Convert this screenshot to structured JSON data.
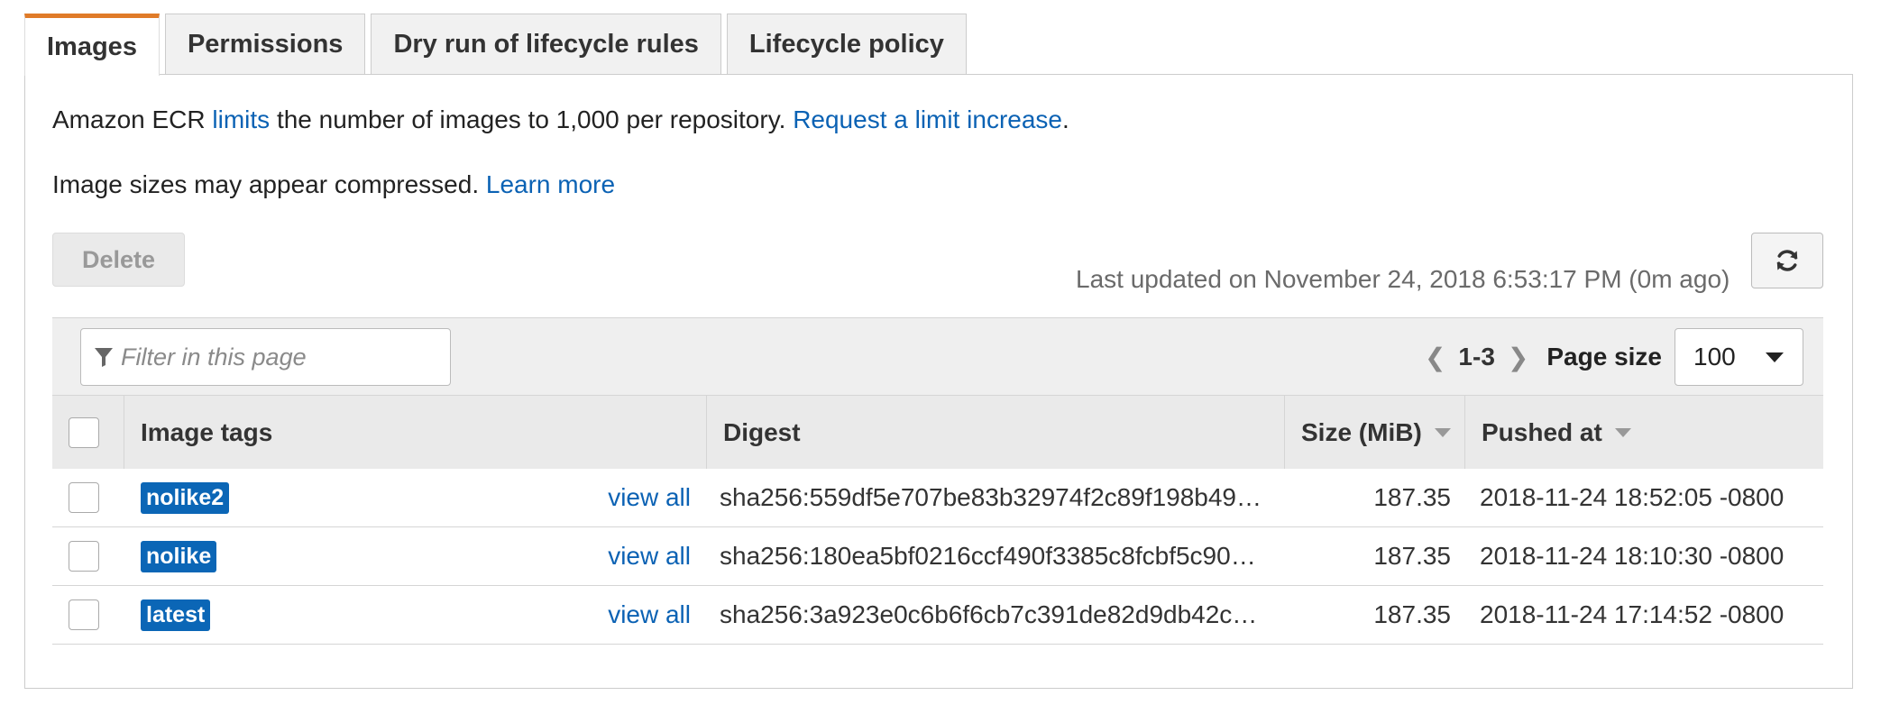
{
  "tabs": [
    {
      "label": "Images",
      "active": true
    },
    {
      "label": "Permissions",
      "active": false
    },
    {
      "label": "Dry run of lifecycle rules",
      "active": false
    },
    {
      "label": "Lifecycle policy",
      "active": false
    }
  ],
  "info": {
    "limits_prefix": "Amazon ECR ",
    "limits_link": "limits",
    "limits_middle": " the number of images to 1,000 per repository. ",
    "limit_increase_link": "Request a limit increase",
    "limits_suffix": ".",
    "compressed_text": "Image sizes may appear compressed. ",
    "learn_more_link": "Learn more"
  },
  "toolbar": {
    "delete_label": "Delete",
    "last_updated": "Last updated on November 24, 2018 6:53:17 PM (0m ago)",
    "refresh_icon": "refresh-icon"
  },
  "filter": {
    "placeholder": "Filter in this page",
    "icon": "filter-icon"
  },
  "pagination": {
    "range": "1-3",
    "page_size_label": "Page size",
    "page_size_value": "100"
  },
  "table": {
    "headers": {
      "image_tags": "Image tags",
      "digest": "Digest",
      "size": "Size (MiB)",
      "pushed_at": "Pushed at"
    },
    "rows": [
      {
        "tag": "nolike2",
        "view_all": "view all",
        "digest": "sha256:559df5e707be83b32974f2c89f198b49…",
        "size": "187.35",
        "pushed_at": "2018-11-24 18:52:05 -0800"
      },
      {
        "tag": "nolike",
        "view_all": "view all",
        "digest": "sha256:180ea5bf0216ccf490f3385c8fcbf5c90…",
        "size": "187.35",
        "pushed_at": "2018-11-24 18:10:30 -0800"
      },
      {
        "tag": "latest",
        "view_all": "view all",
        "digest": "sha256:3a923e0c6b6f6cb7c391de82d9db42c…",
        "size": "187.35",
        "pushed_at": "2018-11-24 17:14:52 -0800"
      }
    ]
  },
  "colors": {
    "accent_tab": "#e07b28",
    "link": "#0b62b4",
    "tag_badge": "#0b66b6"
  }
}
